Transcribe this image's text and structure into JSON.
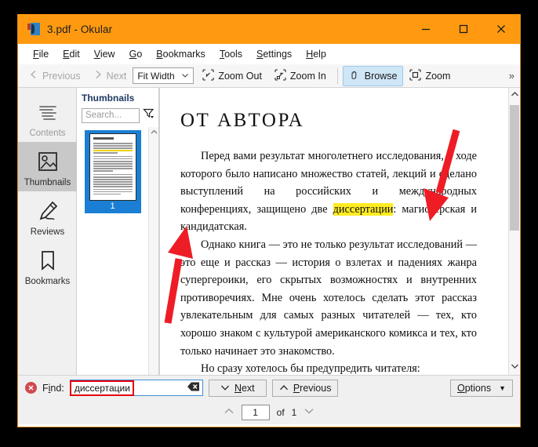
{
  "window": {
    "title": "3.pdf  - Okular",
    "icon": "okular-app-icon",
    "controls": {
      "minimize": "minimize-icon",
      "maximize": "maximize-icon",
      "close": "close-icon"
    }
  },
  "menubar": {
    "items": [
      {
        "label": "File",
        "accel": "F"
      },
      {
        "label": "Edit",
        "accel": "E"
      },
      {
        "label": "View",
        "accel": "V"
      },
      {
        "label": "Go",
        "accel": "G"
      },
      {
        "label": "Bookmarks",
        "accel": "B"
      },
      {
        "label": "Tools",
        "accel": "T"
      },
      {
        "label": "Settings",
        "accel": "S"
      },
      {
        "label": "Help",
        "accel": "H"
      }
    ]
  },
  "toolbar": {
    "previous_label": "Previous",
    "next_label": "Next",
    "zoom_select_value": "Fit Width",
    "zoom_out_label": "Zoom Out",
    "zoom_in_label": "Zoom In",
    "browse_label": "Browse",
    "zoom_label": "Zoom",
    "overflow_label": "»"
  },
  "sidebar": {
    "items": [
      {
        "label": "Contents",
        "icon": "contents-icon",
        "state": "disabled"
      },
      {
        "label": "Thumbnails",
        "icon": "thumbnails-icon",
        "state": "selected"
      },
      {
        "label": "Reviews",
        "icon": "reviews-icon",
        "state": "normal"
      },
      {
        "label": "Bookmarks",
        "icon": "bookmarks-icon",
        "state": "normal"
      }
    ]
  },
  "thumbnails_panel": {
    "title": "Thumbnails",
    "search_placeholder": "Search...",
    "filter_icon": "filter-funnel-icon",
    "pages": [
      {
        "number": "1",
        "selected": true
      }
    ]
  },
  "document": {
    "heading": "ОТ АВТОРА",
    "paragraphs": [
      {
        "indent": true,
        "runs": [
          {
            "text": "Перед вами результат многолетнего исследования, в ходе которого было написано множество статей, лекций и сделано выступлений на российских и международных конференциях, защищено две ",
            "highlight": false
          },
          {
            "text": "диссертации",
            "highlight": true
          },
          {
            "text": ": магистерская и кандидатская.",
            "highlight": false
          }
        ]
      },
      {
        "indent": true,
        "runs": [
          {
            "text": "Однако книга — это не только результат исследований — это еще и рассказ — история о взлетах и падениях жанра супергероики, его скрытых возможностях и внутренних противоречиях. Мне очень хотелось сделать этот рассказ увлекательным для самых разных читателей — тех, кто хорошо знаком с культурой американского комикса и тех, кто только начинает это знакомство.",
            "highlight": false
          }
        ]
      },
      {
        "indent": true,
        "runs": [
          {
            "text": "Но сразу хотелось бы предупредить читателя:",
            "highlight": false
          }
        ]
      }
    ],
    "annotations": [
      {
        "name": "red-arrow-to-highlight-top",
        "color": "#ee1c25"
      },
      {
        "name": "red-arrow-to-highlight-bottom",
        "color": "#ee1c25"
      }
    ]
  },
  "findbar": {
    "close_icon": "close-circle-icon",
    "label": "Find:",
    "value": "диссертации",
    "clear_icon": "clear-text-icon",
    "next_label": "Next",
    "previous_label": "Previous",
    "options_label": "Options",
    "options_caret": "▼"
  },
  "pagenav": {
    "prev_icon": "chevron-up-icon",
    "current_page": "1",
    "of_label": "of",
    "total_pages": "1",
    "next_icon": "chevron-down-icon"
  },
  "colors": {
    "titlebar": "#ff9a10",
    "accent_border": "#d9901f",
    "selection_blue": "#1a7fd4",
    "highlight_yellow": "#ffec22",
    "annotation_red": "#ee1c25",
    "active_toolbutton": "#cfe6f7"
  }
}
